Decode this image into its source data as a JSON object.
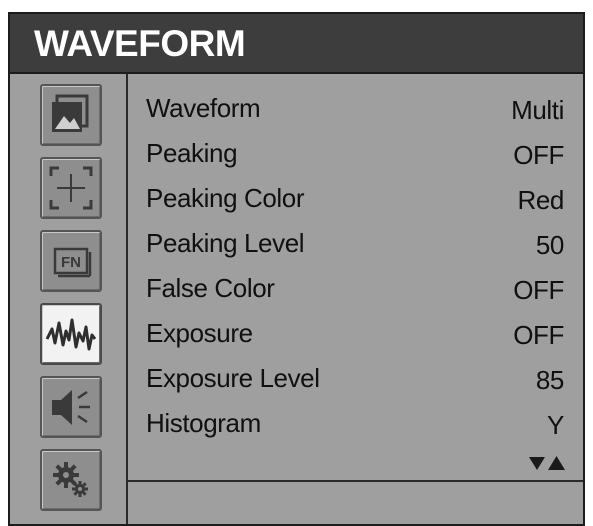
{
  "menu_title": "WAVEFORM",
  "sidebar": {
    "items": [
      {
        "icon": "picture-icon",
        "active": false
      },
      {
        "icon": "marker-icon",
        "active": false
      },
      {
        "icon": "fn-icon",
        "active": false
      },
      {
        "icon": "waveform-icon",
        "active": true
      },
      {
        "icon": "speaker-icon",
        "active": false
      },
      {
        "icon": "settings-gears-icon",
        "active": false
      }
    ]
  },
  "menu": {
    "items": [
      {
        "label": "Waveform",
        "value": "Multi"
      },
      {
        "label": "Peaking",
        "value": "OFF"
      },
      {
        "label": "Peaking Color",
        "value": "Red"
      },
      {
        "label": "Peaking Level",
        "value": "50"
      },
      {
        "label": "False Color",
        "value": "OFF"
      },
      {
        "label": "Exposure",
        "value": "OFF"
      },
      {
        "label": "Exposure Level",
        "value": "85"
      },
      {
        "label": "Histogram",
        "value": "Y"
      }
    ],
    "scroll_icon": "scroll-down-up-icon"
  },
  "colors": {
    "background": "#9f9f9f",
    "title_bar": "#3d3d3d",
    "title_text": "#ffffff",
    "active_icon_bg": "#f2f2f2"
  }
}
